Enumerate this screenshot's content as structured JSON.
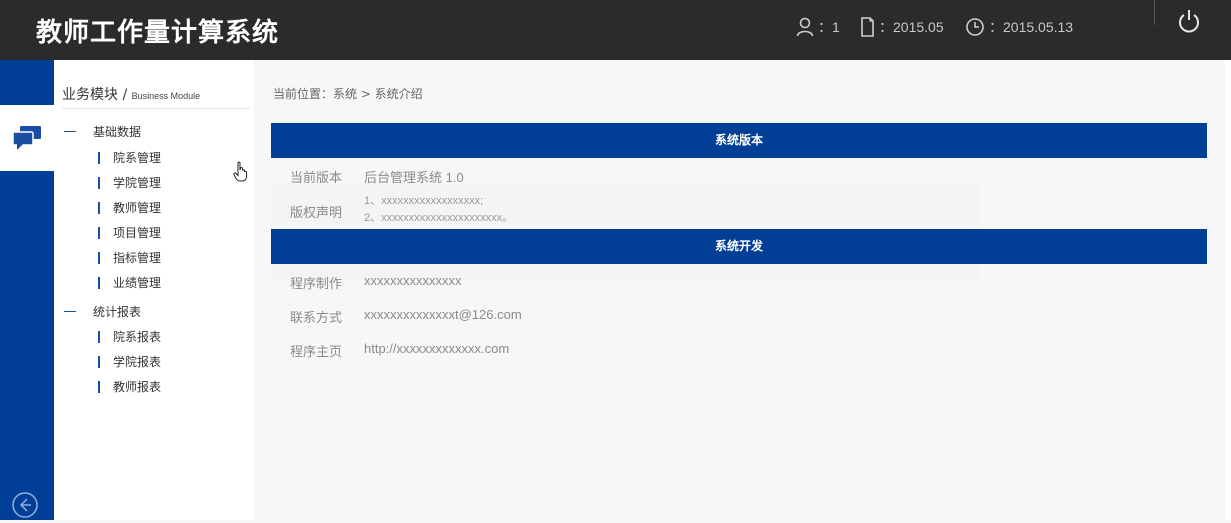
{
  "header": {
    "title": "教师工作量计算系统",
    "user_count": "：1",
    "term": "：2015.05",
    "date": "：2015.05.13"
  },
  "sidebar": {
    "module_title": "业务模块",
    "module_sep": " / ",
    "module_subtitle": "Business Module",
    "groups": [
      {
        "label": "基础数据",
        "items": [
          "院系管理",
          "学院管理",
          "教师管理",
          "项目管理",
          "指标管理",
          "业绩管理"
        ]
      },
      {
        "label": "统计报表",
        "items": [
          "院系报表",
          "学院报表",
          "教师报表"
        ]
      }
    ]
  },
  "main": {
    "breadcrumb": "当前位置：系统 > 系统介绍",
    "version_section": {
      "title": "系统版本",
      "current_label": "当前版本",
      "current_value": "后台管理系统 1.0",
      "copyright_label": "版权声明",
      "copyright_lines": [
        "1、xxxxxxxxxxxxxxxxxx;",
        "2、xxxxxxxxxxxxxxxxxxxxxx。"
      ]
    },
    "dev_section": {
      "title": "系统开发",
      "maker_label": "程序制作",
      "maker_value": "xxxxxxxxxxxxxxx",
      "contact_label": "联系方式",
      "contact_value": "xxxxxxxxxxxxxxt@126.com",
      "home_label": "程序主页",
      "home_value": "http://xxxxxxxxxxxxx.com"
    }
  },
  "colors": {
    "header_bg": "#2b2b2b",
    "accent": "#013f96"
  },
  "icons": [
    "user-icon",
    "document-icon",
    "clock-icon",
    "power-icon",
    "chat-icon",
    "back-arrow-icon",
    "hand-cursor-icon"
  ]
}
